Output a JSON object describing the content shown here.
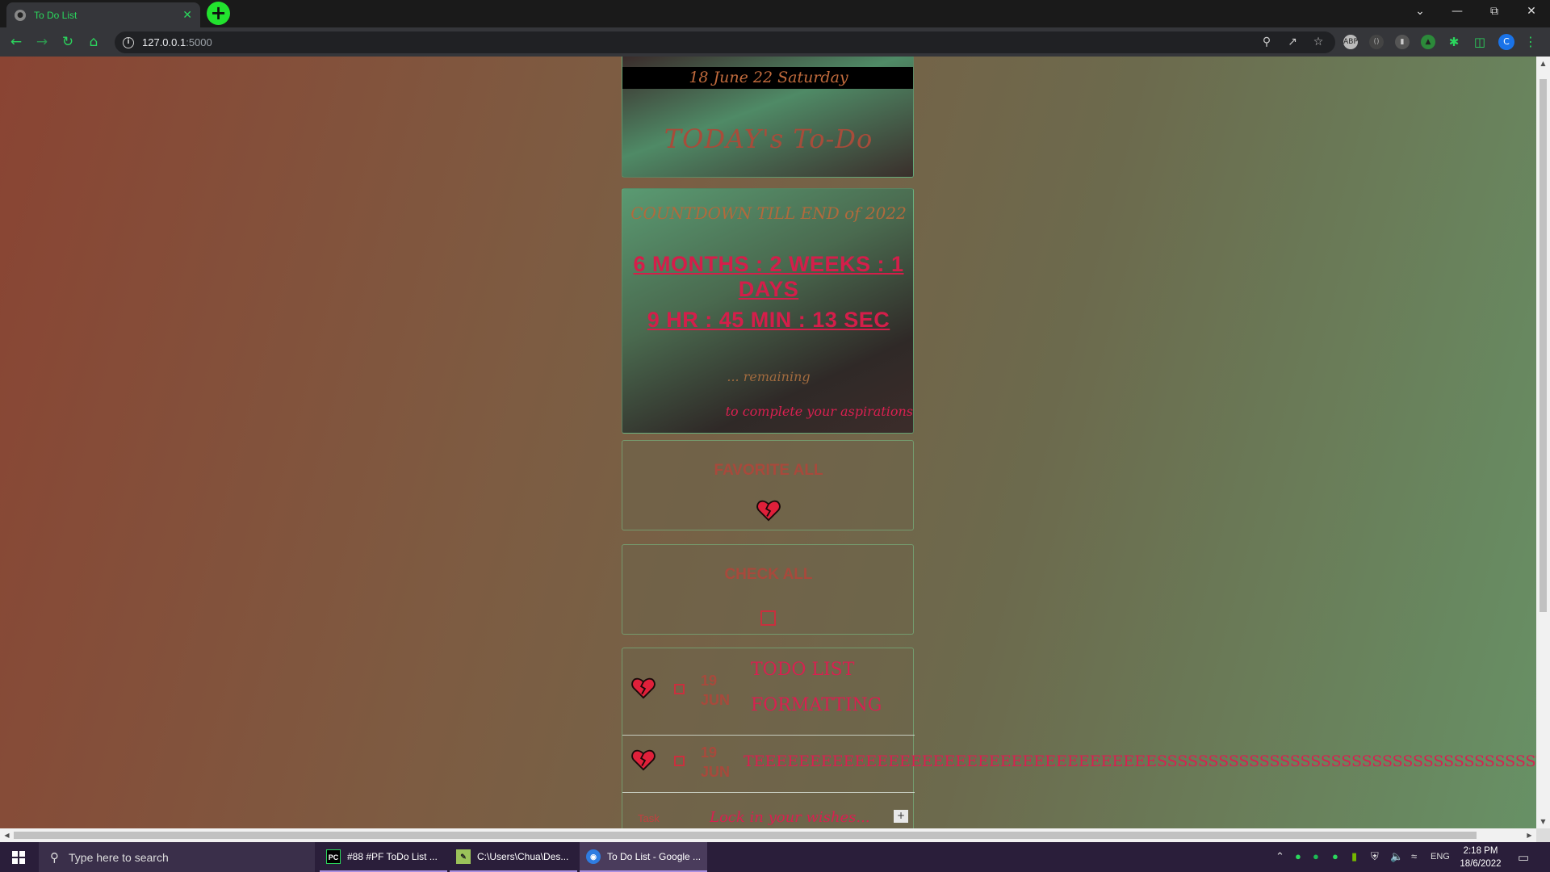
{
  "browser": {
    "tab_title": "To Do List",
    "url_host": "127.0.0.1",
    "url_port": ":5000",
    "profile_initial": "C"
  },
  "page": {
    "date_banner": "18 June 22 Saturday",
    "title": "TODAY's To-Do",
    "countdown": {
      "heading": "COUNTDOWN TILL END of 2022",
      "line1": "6 MONTHS : 2 WEEKS : 1 DAYS",
      "line2": "9 HR : 45 MIN : 13 SEC",
      "remaining": "... remaining",
      "tagline": "to complete your aspirations"
    },
    "favorite_all_label": "FAVORITE ALL",
    "check_all_label": "CHECK ALL",
    "tasks": [
      {
        "day": "19",
        "month": "JUNE",
        "text_line1": "TODO LIST",
        "text_line2": "FORMATTING",
        "favorite": true,
        "checked": false
      },
      {
        "day": "19",
        "month": "JUNE",
        "text_line1": "TEEEEEEEEEEEEEEEEEEEEEEEEEEEEEEEEEEEESSSSSSSSSSSSSSSSSSSSSSSSSSSSSSSSSSSSSTTTTTTTTTTTTTTTTTTT",
        "favorite": true,
        "checked": false
      }
    ],
    "new_task": {
      "label": "Task",
      "placeholder": "Lock in your wishes...",
      "add_label": "+"
    }
  },
  "taskbar": {
    "search_placeholder": "Type here to search",
    "apps": [
      {
        "label": "#88 #PF ToDo List ...",
        "icon": "pycharm-icon"
      },
      {
        "label": "C:\\Users\\Chua\\Des...",
        "icon": "notepad-icon"
      },
      {
        "label": "To Do List - Google ...",
        "icon": "chrome-icon"
      }
    ],
    "language": "ENG",
    "time": "2:18 PM",
    "date": "18/6/2022"
  },
  "colors": {
    "accent_red": "#d82050",
    "brown_text": "#a8493c",
    "browser_green": "#2bd65d"
  }
}
